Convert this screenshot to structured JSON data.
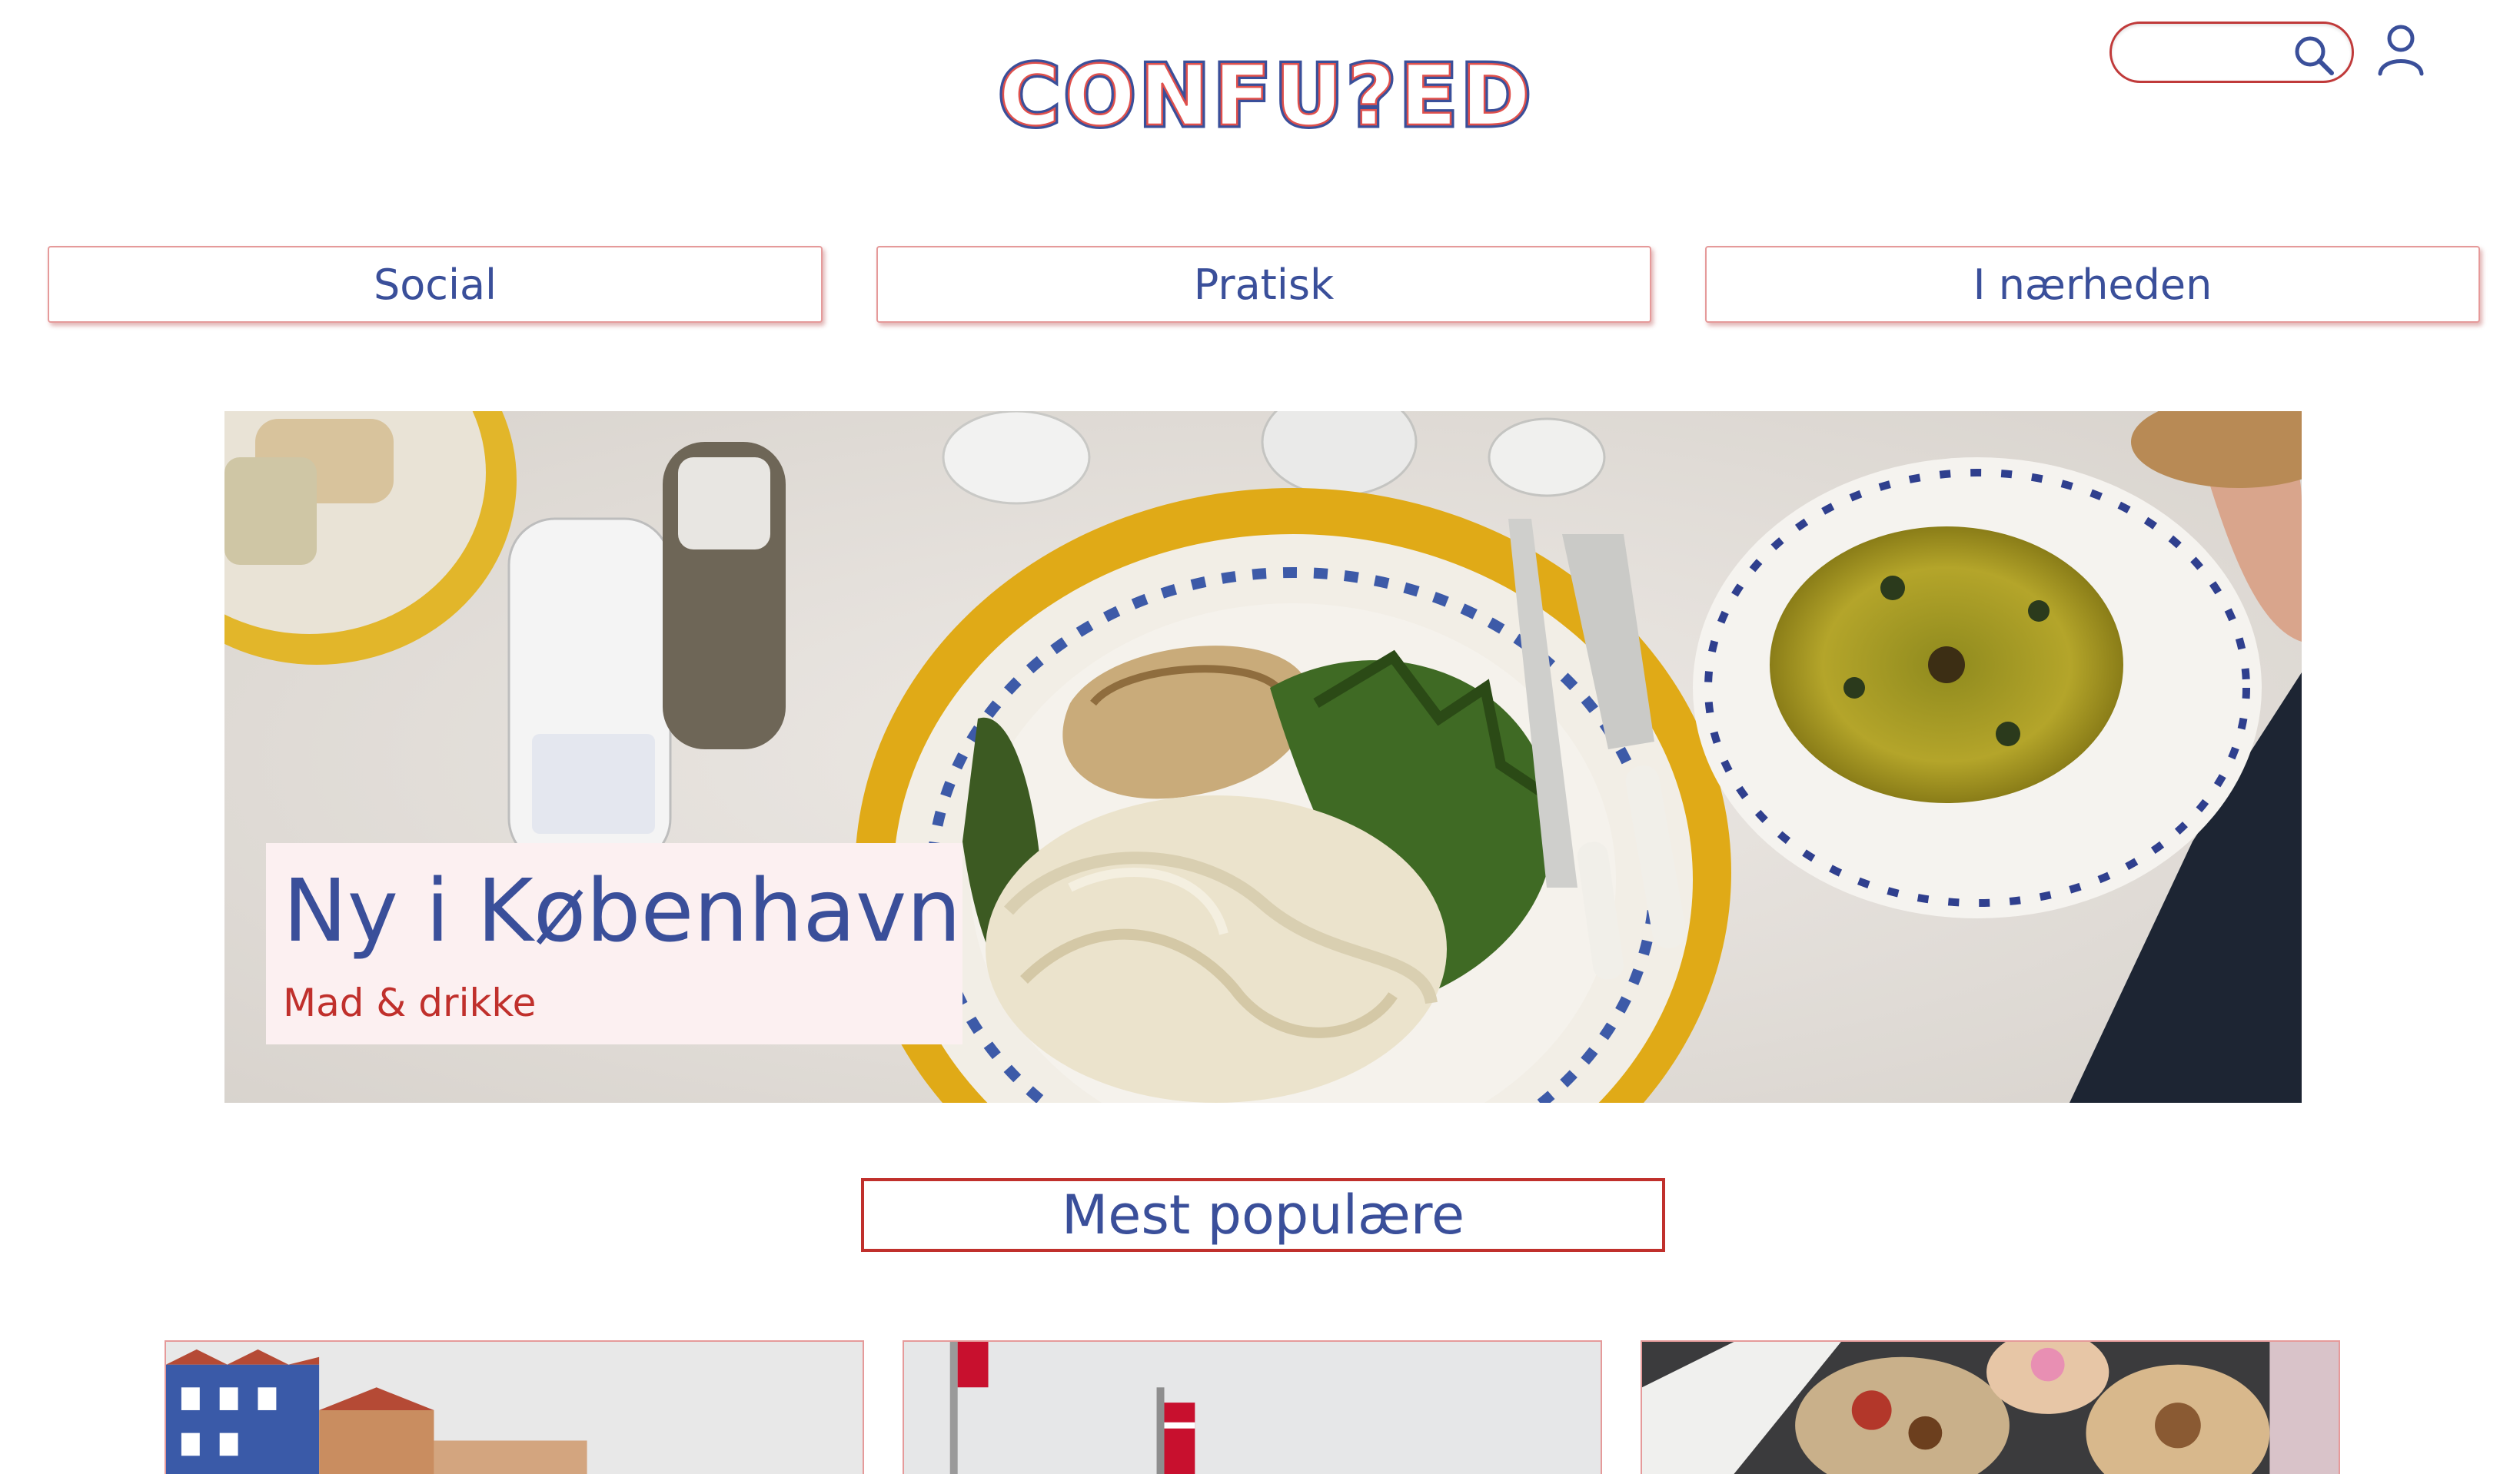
{
  "header": {
    "logo_text": "CONFU?ED",
    "search": {
      "placeholder": "",
      "value": ""
    },
    "icons": {
      "search": "search-icon",
      "user": "user-icon"
    }
  },
  "nav": {
    "items": [
      {
        "label": "Social"
      },
      {
        "label": "Pratisk"
      },
      {
        "label": "I nærheden"
      }
    ]
  },
  "hero": {
    "title": "Ny i København",
    "subtitle": "Mad & drikke"
  },
  "popular": {
    "label": "Mest populære"
  },
  "colors": {
    "brand_blue": "#3a4f9a",
    "accent_red": "#c0302c",
    "caption_bg": "#fcf0f1"
  }
}
